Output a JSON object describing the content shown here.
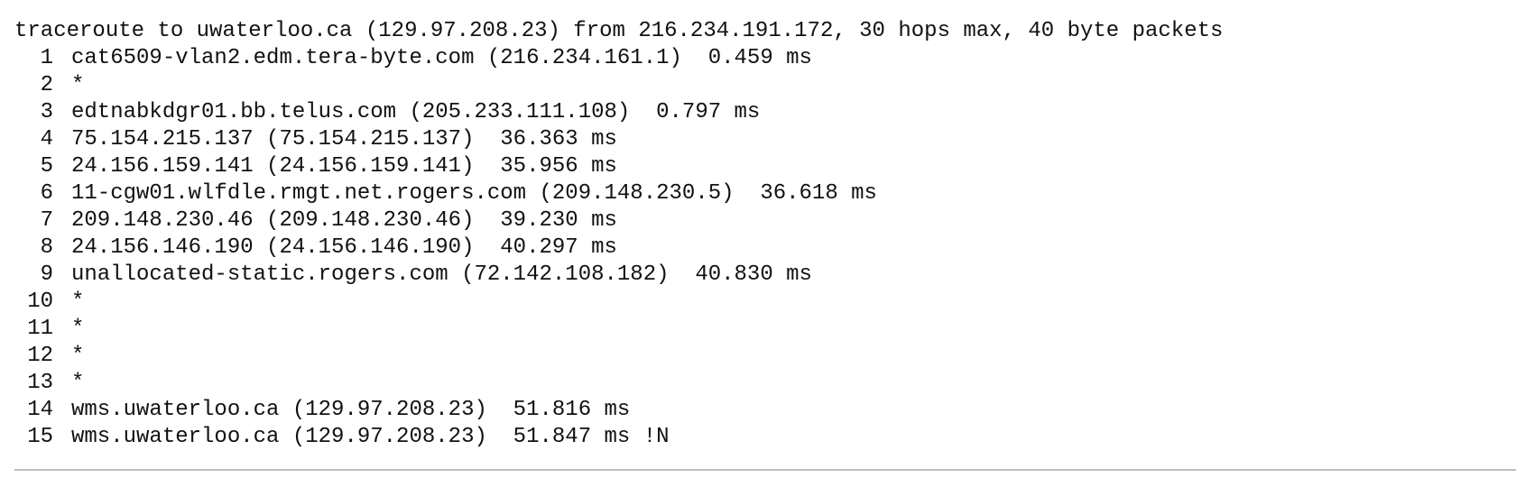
{
  "traceroute": {
    "header": "traceroute to uwaterloo.ca (129.97.208.23) from 216.234.191.172, 30 hops max, 40 byte packets",
    "hops": [
      {
        "num": "1",
        "text": "cat6509-vlan2.edm.tera-byte.com (216.234.161.1)  0.459 ms"
      },
      {
        "num": "2",
        "text": "*"
      },
      {
        "num": "3",
        "text": "edtnabkdgr01.bb.telus.com (205.233.111.108)  0.797 ms"
      },
      {
        "num": "4",
        "text": "75.154.215.137 (75.154.215.137)  36.363 ms"
      },
      {
        "num": "5",
        "text": "24.156.159.141 (24.156.159.141)  35.956 ms"
      },
      {
        "num": "6",
        "text": "11-cgw01.wlfdle.rmgt.net.rogers.com (209.148.230.5)  36.618 ms"
      },
      {
        "num": "7",
        "text": "209.148.230.46 (209.148.230.46)  39.230 ms"
      },
      {
        "num": "8",
        "text": "24.156.146.190 (24.156.146.190)  40.297 ms"
      },
      {
        "num": "9",
        "text": "unallocated-static.rogers.com (72.142.108.182)  40.830 ms"
      },
      {
        "num": "10",
        "text": "*"
      },
      {
        "num": "11",
        "text": "*"
      },
      {
        "num": "12",
        "text": "*"
      },
      {
        "num": "13",
        "text": "*"
      },
      {
        "num": "14",
        "text": "wms.uwaterloo.ca (129.97.208.23)  51.816 ms"
      },
      {
        "num": "15",
        "text": "wms.uwaterloo.ca (129.97.208.23)  51.847 ms !N"
      }
    ]
  }
}
